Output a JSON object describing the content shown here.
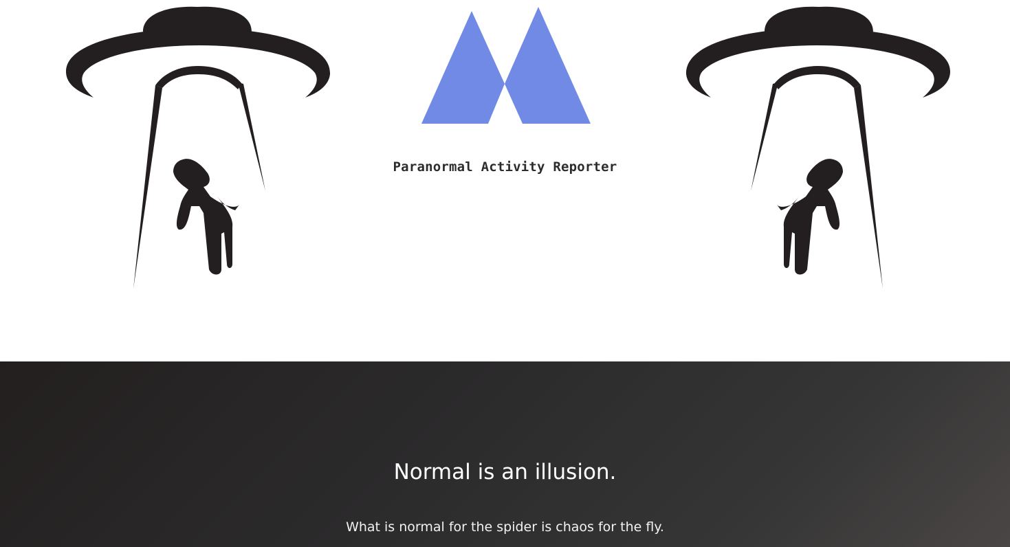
{
  "header": {
    "title": "Paranormal Activity Reporter",
    "logo_color": "#718ae6",
    "icons": [
      "ufo-abduction-icon",
      "logo-icon",
      "ufo-abduction-icon"
    ]
  },
  "hero": {
    "title": "Normal is an illusion.",
    "subtitle": "What is normal for the spider is chaos for the fly."
  },
  "colors": {
    "dark_bg": "#231f1f",
    "ink": "#231f20",
    "white": "#ffffff"
  }
}
